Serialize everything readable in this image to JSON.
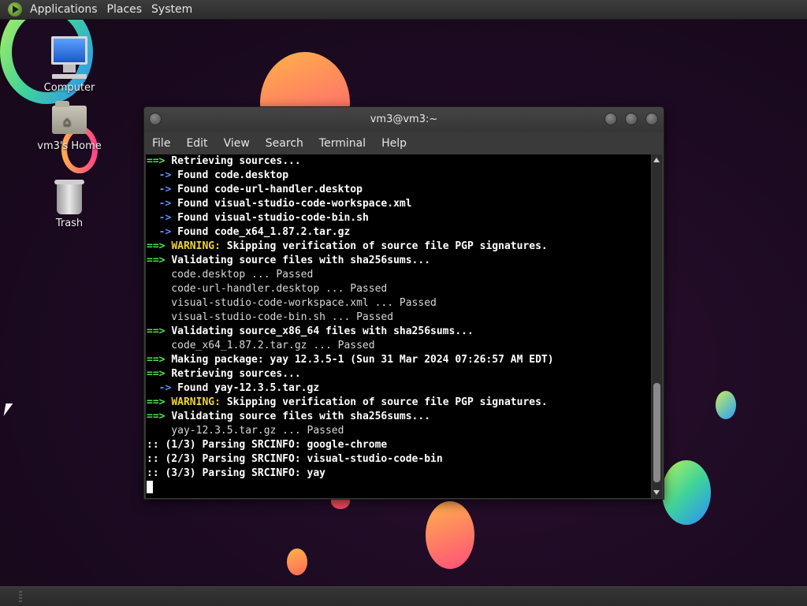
{
  "top_panel": {
    "menus": [
      "Applications",
      "Places",
      "System"
    ]
  },
  "desktop": {
    "icons": [
      {
        "label": "Computer",
        "icon": "computer-icon"
      },
      {
        "label": "vm3's Home",
        "icon": "home-folder-icon"
      },
      {
        "label": "Trash",
        "icon": "trash-icon"
      }
    ]
  },
  "terminal": {
    "title": "vm3@vm3:~",
    "menu": [
      "File",
      "Edit",
      "View",
      "Search",
      "Terminal",
      "Help"
    ],
    "lines": [
      {
        "kind": "section",
        "text": "Retrieving sources..."
      },
      {
        "kind": "sub",
        "text": "Found code.desktop"
      },
      {
        "kind": "sub",
        "text": "Found code-url-handler.desktop"
      },
      {
        "kind": "sub",
        "text": "Found visual-studio-code-workspace.xml"
      },
      {
        "kind": "sub",
        "text": "Found visual-studio-code-bin.sh"
      },
      {
        "kind": "sub",
        "text": "Found code_x64_1.87.2.tar.gz"
      },
      {
        "kind": "warning",
        "label": "WARNING:",
        "text": " Skipping verification of source file PGP signatures."
      },
      {
        "kind": "section",
        "text": "Validating source files with sha256sums..."
      },
      {
        "kind": "plain",
        "text": "    code.desktop ... Passed"
      },
      {
        "kind": "plain",
        "text": "    code-url-handler.desktop ... Passed"
      },
      {
        "kind": "plain",
        "text": "    visual-studio-code-workspace.xml ... Passed"
      },
      {
        "kind": "plain",
        "text": "    visual-studio-code-bin.sh ... Passed"
      },
      {
        "kind": "section",
        "text": "Validating source_x86_64 files with sha256sums..."
      },
      {
        "kind": "plain",
        "text": "    code_x64_1.87.2.tar.gz ... Passed"
      },
      {
        "kind": "section",
        "text": "Making package: yay 12.3.5-1 (Sun 31 Mar 2024 07:26:57 AM EDT)"
      },
      {
        "kind": "section",
        "text": "Retrieving sources..."
      },
      {
        "kind": "sub",
        "text": "Found yay-12.3.5.tar.gz"
      },
      {
        "kind": "warning",
        "label": "WARNING:",
        "text": " Skipping verification of source file PGP signatures."
      },
      {
        "kind": "section",
        "text": "Validating source files with sha256sums..."
      },
      {
        "kind": "plain",
        "text": "    yay-12.3.5.tar.gz ... Passed"
      },
      {
        "kind": "colon",
        "text": ":: (1/3) Parsing SRCINFO: google-chrome"
      },
      {
        "kind": "colon",
        "text": ":: (2/3) Parsing SRCINFO: visual-studio-code-bin"
      },
      {
        "kind": "colon",
        "text": ":: (3/3) Parsing SRCINFO: yay"
      },
      {
        "kind": "cursor",
        "text": ""
      }
    ],
    "prefixes": {
      "section": "==> ",
      "sub": "  -> "
    }
  },
  "colors": {
    "section_arrow": "#4ee44e",
    "sub_arrow": "#5b8cff",
    "warning": "#f2d33a"
  }
}
